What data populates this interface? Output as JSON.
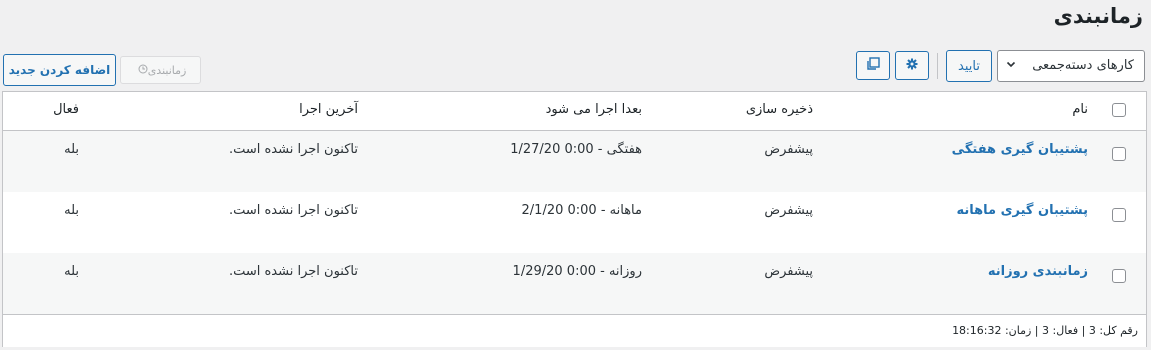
{
  "page": {
    "title": "زمانبندی"
  },
  "toolbar": {
    "add_label": "اضافه کردن جدید",
    "schedule_label": "زمانبندی",
    "schedule_icon": "clock-icon",
    "copy_icon": "copy-icon",
    "gear_icon": "gear-icon",
    "apply_label": "تایید",
    "bulk_select_value": "کارهای دسته‌جمعی"
  },
  "table": {
    "headers": {
      "name": "نام",
      "storage": "ذخیره سازی",
      "next_run": "بعدا اجرا می شود",
      "last_run": "آخرین اجرا",
      "active": "فعال"
    },
    "rows": [
      {
        "name": "پشتیبان گیری هفتگی",
        "storage": "پیشفرض",
        "next_run": "1/27/20 0:00 - هفتگی",
        "last_run": "تاکنون اجرا نشده است.",
        "active": "بله"
      },
      {
        "name": "پشتیبان گیری ماهانه",
        "storage": "پیشفرض",
        "next_run": "2/1/20 0:00 - ماهانه",
        "last_run": "تاکنون اجرا نشده است.",
        "active": "بله"
      },
      {
        "name": "زمانبندی روزانه",
        "storage": "پیشفرض",
        "next_run": "1/29/20 0:00 - روزانه",
        "last_run": "تاکنون اجرا نشده است.",
        "active": "بله"
      }
    ],
    "footer": "رقم کل: 3 | فعال: 3 | زمان: 18:16:32"
  },
  "colors": {
    "accent": "#2271b1",
    "background": "#f0f0f1",
    "border": "#c3c4c7"
  }
}
